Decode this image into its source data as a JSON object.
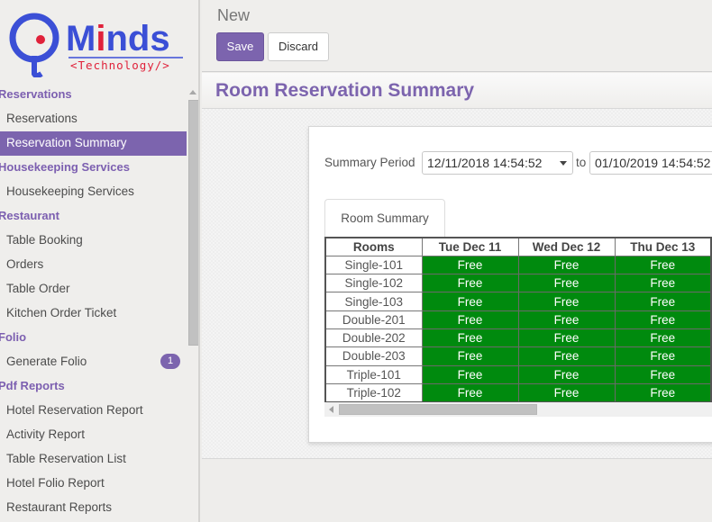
{
  "brand": {
    "name_prefix": "M",
    "name_i": "i",
    "name_suffix": "nds",
    "tagline": "<Technology/>",
    "colors": {
      "blue": "#3b4fd6",
      "red": "#e0213a",
      "tagline": "#e0213a"
    }
  },
  "sidebar": {
    "sections": [
      {
        "header": "Reservations",
        "items": [
          {
            "label": "Reservations",
            "active": false
          },
          {
            "label": "Reservation Summary",
            "active": true
          }
        ]
      },
      {
        "header": "Housekeeping Services",
        "items": [
          {
            "label": "Housekeeping Services",
            "active": false
          }
        ]
      },
      {
        "header": "Restaurant",
        "items": [
          {
            "label": "Table Booking",
            "active": false
          },
          {
            "label": "Orders",
            "active": false
          },
          {
            "label": "Table Order",
            "active": false
          },
          {
            "label": "Kitchen Order Ticket",
            "active": false
          }
        ]
      },
      {
        "header": "Folio",
        "items": [
          {
            "label": "Generate Folio",
            "active": false,
            "badge": "1"
          }
        ]
      },
      {
        "header": "Pdf Reports",
        "items": [
          {
            "label": "Hotel Reservation Report",
            "active": false
          },
          {
            "label": "Activity Report",
            "active": false
          },
          {
            "label": "Table Reservation List",
            "active": false
          },
          {
            "label": "Hotel Folio Report",
            "active": false
          },
          {
            "label": "Restaurant Reports",
            "active": false
          }
        ]
      }
    ]
  },
  "control_panel": {
    "breadcrumb": "New",
    "save_label": "Save",
    "discard_label": "Discard"
  },
  "form": {
    "title": "Room Reservation Summary",
    "period_label": "Summary Period",
    "date_from": "12/11/2018 14:54:52",
    "to_label": "to",
    "date_to": "01/10/2019 14:54:52",
    "tab_label": "Room Summary"
  },
  "summary_table": {
    "columns": [
      "Rooms",
      "Tue Dec 11",
      "Wed Dec 12",
      "Thu Dec 13"
    ],
    "rows": [
      {
        "room": "Single-101",
        "status": [
          "Free",
          "Free",
          "Free"
        ]
      },
      {
        "room": "Single-102",
        "status": [
          "Free",
          "Free",
          "Free"
        ]
      },
      {
        "room": "Single-103",
        "status": [
          "Free",
          "Free",
          "Free"
        ]
      },
      {
        "room": "Double-201",
        "status": [
          "Free",
          "Free",
          "Free"
        ]
      },
      {
        "room": "Double-202",
        "status": [
          "Free",
          "Free",
          "Free"
        ]
      },
      {
        "room": "Double-203",
        "status": [
          "Free",
          "Free",
          "Free"
        ]
      },
      {
        "room": "Triple-101",
        "status": [
          "Free",
          "Free",
          "Free"
        ]
      },
      {
        "room": "Triple-102",
        "status": [
          "Free",
          "Free",
          "Free"
        ]
      }
    ],
    "free_color": "#008a0e"
  },
  "theme": {
    "accent": "#7c64ae"
  }
}
